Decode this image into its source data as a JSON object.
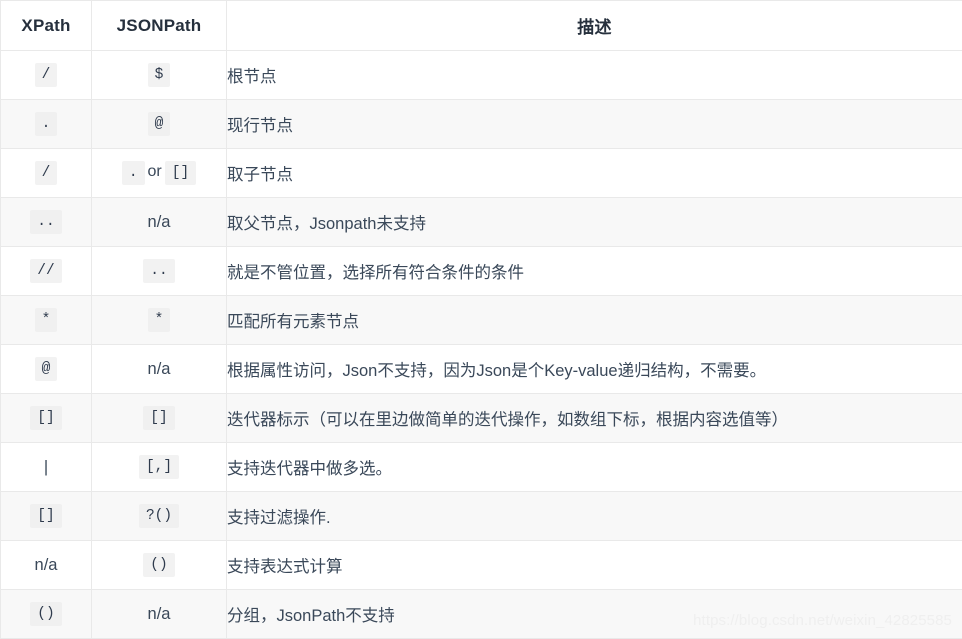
{
  "table": {
    "headers": {
      "xpath": "XPath",
      "jsonpath": "JSONPath",
      "description": "描述"
    },
    "rows": [
      {
        "xpath": "/",
        "xpath_code": true,
        "jsonpath": "$",
        "jsonpath_code": true,
        "description": "根节点"
      },
      {
        "xpath": ".",
        "xpath_code": true,
        "jsonpath": "@",
        "jsonpath_code": true,
        "description": "现行节点"
      },
      {
        "xpath": "/",
        "xpath_code": true,
        "jsonpath_parts": [
          {
            "text": ".",
            "code": true
          },
          {
            "text": "or",
            "code": false
          },
          {
            "text": "[]",
            "code": true
          }
        ],
        "jsonpath": ". or []",
        "description": "取子节点"
      },
      {
        "xpath": "..",
        "xpath_code": true,
        "jsonpath": "n/a",
        "jsonpath_code": false,
        "description": "取父节点，Jsonpath未支持"
      },
      {
        "xpath": "//",
        "xpath_code": true,
        "jsonpath": "..",
        "jsonpath_code": true,
        "description": "就是不管位置，选择所有符合条件的条件"
      },
      {
        "xpath": "*",
        "xpath_code": true,
        "jsonpath": "*",
        "jsonpath_code": true,
        "description": "匹配所有元素节点"
      },
      {
        "xpath": "@",
        "xpath_code": true,
        "jsonpath": "n/a",
        "jsonpath_code": false,
        "description": "根据属性访问，Json不支持，因为Json是个Key-value递归结构，不需要。"
      },
      {
        "xpath": "[]",
        "xpath_code": true,
        "jsonpath": "[]",
        "jsonpath_code": true,
        "description": "迭代器标示（可以在里边做简单的迭代操作，如数组下标，根据内容选值等）"
      },
      {
        "xpath": "|",
        "xpath_code": false,
        "jsonpath": "[,]",
        "jsonpath_code": true,
        "description": "支持迭代器中做多选。"
      },
      {
        "xpath": "[]",
        "xpath_code": true,
        "jsonpath": "?()",
        "jsonpath_code": true,
        "description": "支持过滤操作."
      },
      {
        "xpath": "n/a",
        "xpath_code": false,
        "jsonpath": "()",
        "jsonpath_code": true,
        "description": "支持表达式计算"
      },
      {
        "xpath": "()",
        "xpath_code": true,
        "jsonpath": "n/a",
        "jsonpath_code": false,
        "description": "分组，JsonPath不支持"
      }
    ]
  },
  "watermark": "https://blog.csdn.net/weixin_42825585",
  "colors": {
    "text": "#3a4859",
    "header_text": "#26303d",
    "border": "#e9e9e9",
    "row_alt_bg": "#f8f8f8",
    "code_bg": "#f2f2f2",
    "watermark": "#efefef"
  }
}
